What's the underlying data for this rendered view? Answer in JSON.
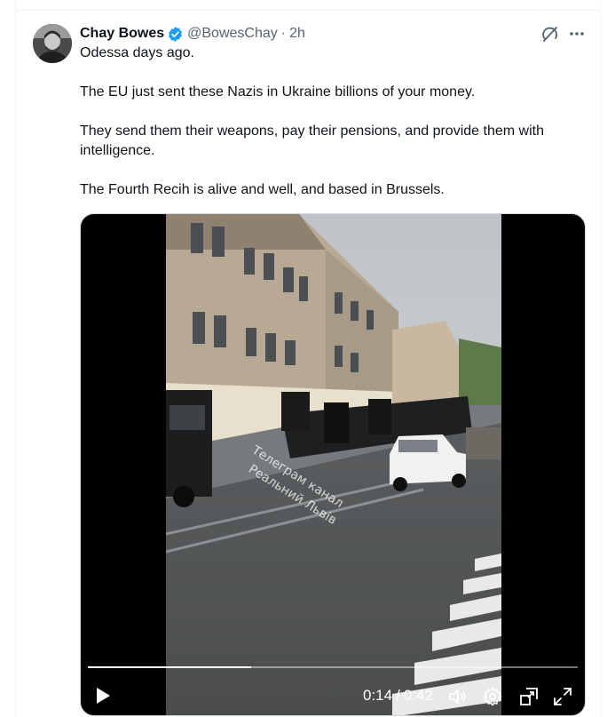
{
  "tweet": {
    "display_name": "Chay Bowes",
    "handle": "@BowesChay",
    "separator": "·",
    "time": "2h",
    "verified": true,
    "paragraphs": [
      "Odessa days ago.",
      "The EU just sent these Nazis in Ukraine billions of your money.",
      "They send them their weapons, pay their pensions, and provide them with intelligence.",
      "The Fourth Recih is alive and well, and based in Brussels."
    ]
  },
  "icons": {
    "verified": "verified-badge-icon",
    "grok": "grok-icon",
    "more": "more-icon",
    "play": "play-icon",
    "volume": "volume-icon",
    "settings": "gear-icon",
    "pip": "picture-in-picture-icon",
    "fullscreen": "fullscreen-icon"
  },
  "video": {
    "current_time": "0:14",
    "separator": "/",
    "duration": "0:42",
    "progress_fraction": 0.333,
    "watermark_lines": [
      "Телеграм канал",
      "Реальний Львів"
    ]
  },
  "colors": {
    "accent": "#1d9bf0",
    "text_primary": "#0f1419",
    "text_secondary": "#536471",
    "border": "#eff3f4"
  }
}
